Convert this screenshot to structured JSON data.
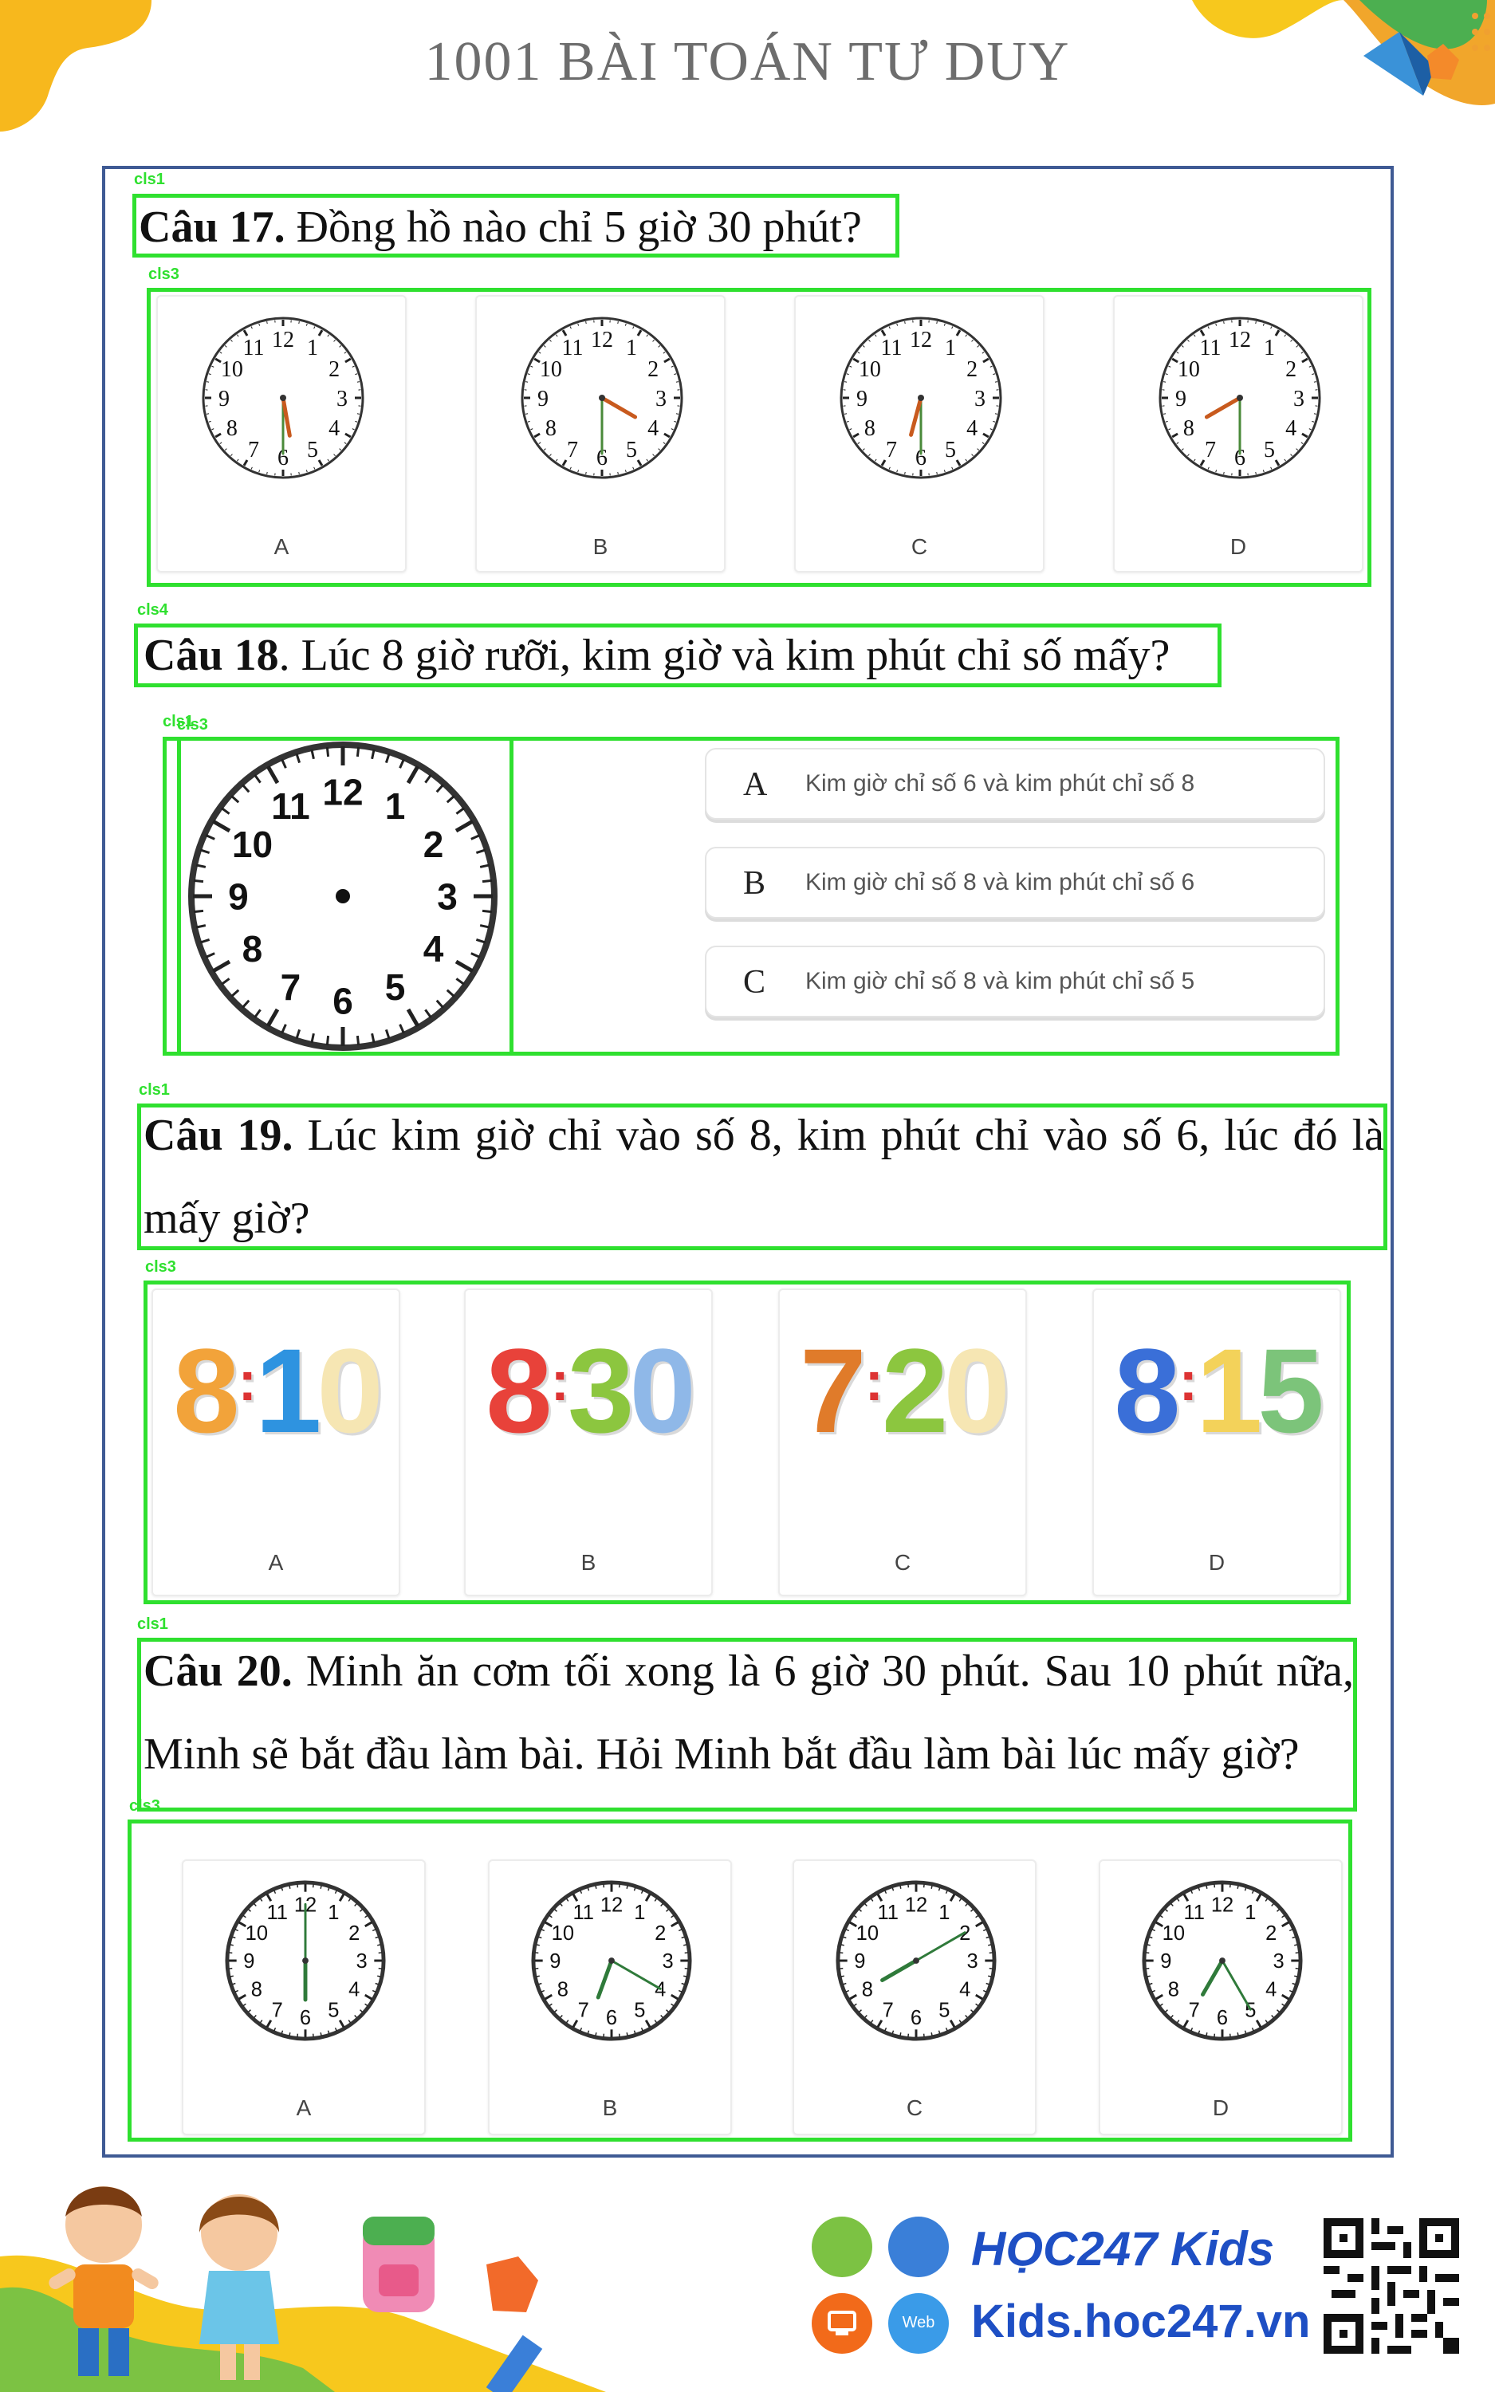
{
  "header": {
    "title": "1001 BÀI TOÁN TƯ DUY"
  },
  "tags": {
    "cls1": "cls1",
    "cls3": "cls3",
    "cls4": "cls4",
    "cls3_overlap": "cls3"
  },
  "q17": {
    "number": "Câu 17.",
    "text": " Đồng hồ nào chỉ 5 giờ 30 phút?",
    "options": [
      {
        "label": "A",
        "hour_deg": 170,
        "min_deg": 180
      },
      {
        "label": "B",
        "hour_deg": 120,
        "min_deg": 180
      },
      {
        "label": "C",
        "hour_deg": 195,
        "min_deg": 180
      },
      {
        "label": "D",
        "hour_deg": 240,
        "min_deg": 180
      }
    ]
  },
  "q18": {
    "number": "Câu 18",
    "text": ". Lúc 8 giờ rưỡi, kim giờ và kim phút chỉ số mấy?",
    "answers": [
      {
        "letter": "A",
        "text": "Kim giờ chỉ số 6 và kim phút chỉ số 8"
      },
      {
        "letter": "B",
        "text": "Kim giờ chỉ số 8 và kim phút chỉ số 6"
      },
      {
        "letter": "C",
        "text": "Kim giờ chỉ số 8 và kim phút chỉ số 5"
      }
    ]
  },
  "q19": {
    "number": "Câu 19.",
    "text": " Lúc kim giờ chỉ vào số 8, kim phút chỉ vào số 6, lúc đó là mấy giờ?",
    "options": [
      {
        "label": "A",
        "hh": "8",
        "mm": "10",
        "colors": [
          "#f2a33a",
          "#2e93e0",
          "#f6e6b3"
        ]
      },
      {
        "label": "B",
        "hh": "8",
        "mm": "30",
        "colors": [
          "#e8423a",
          "#8cc63f",
          "#8fb8e8"
        ]
      },
      {
        "label": "C",
        "hh": "7",
        "mm": "20",
        "colors": [
          "#e07b2a",
          "#8cc63f",
          "#f6e6b3"
        ]
      },
      {
        "label": "D",
        "hh": "8",
        "mm": "15",
        "colors": [
          "#3a6fd8",
          "#f3d25a",
          "#7cc47a"
        ]
      }
    ]
  },
  "q20": {
    "number": "Câu 20.",
    "text": " Minh ăn cơm tối xong là 6 giờ 30 phút. Sau 10 phút nữa, Minh sẽ bắt đầu làm bài. Hỏi Minh bắt đầu làm bài lúc mấy giờ?",
    "options": [
      {
        "label": "A",
        "hour_deg": 180,
        "min_deg": 0
      },
      {
        "label": "B",
        "hour_deg": 200,
        "min_deg": 120
      },
      {
        "label": "C",
        "hour_deg": 240,
        "min_deg": 60
      },
      {
        "label": "D",
        "hour_deg": 210,
        "min_deg": 150
      }
    ]
  },
  "footer": {
    "brand": "HỌC247",
    "brand_kids": "Kids",
    "url": "Kids.hoc247.vn",
    "web_badge": "Web"
  },
  "colors": {
    "accent": "#2fe02f",
    "frame": "#3f5a94",
    "brand": "#1e4fc4"
  }
}
